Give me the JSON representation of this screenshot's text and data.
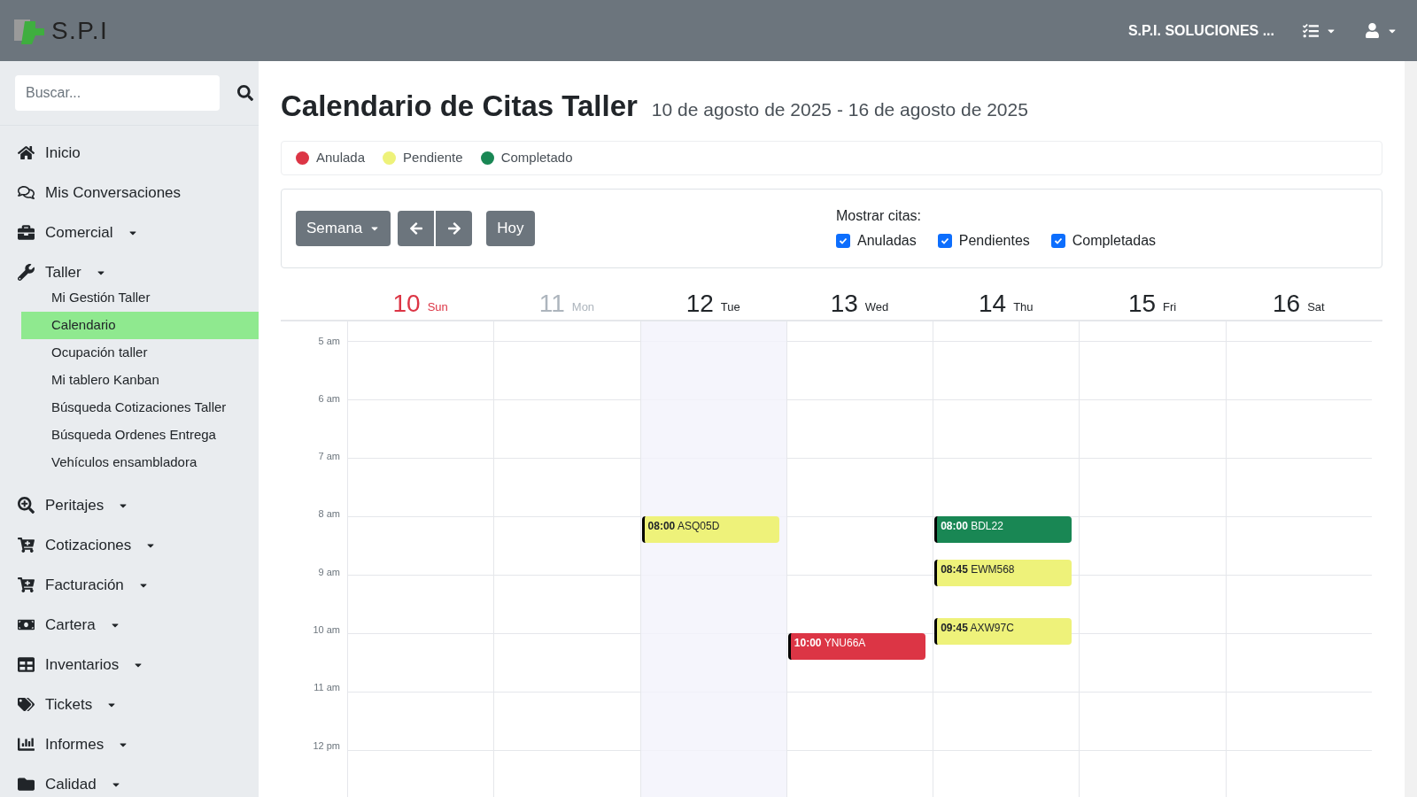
{
  "header": {
    "logo_text": "S.P.I",
    "company": "S.P.I. SOLUCIONES ..."
  },
  "sidebar": {
    "search": {
      "placeholder": "Buscar..."
    },
    "items": [
      {
        "label": "Inicio",
        "dropdown": false
      },
      {
        "label": "Mis Conversaciones",
        "dropdown": false
      },
      {
        "label": "Comercial",
        "dropdown": true
      },
      {
        "label": "Taller",
        "dropdown": true,
        "children": [
          {
            "label": "Mi Gestión Taller",
            "selected": false
          },
          {
            "label": "Calendario",
            "selected": true
          },
          {
            "label": "Ocupación taller",
            "selected": false
          },
          {
            "label": "Mi tablero Kanban",
            "selected": false
          },
          {
            "label": "Búsqueda Cotizaciones Taller",
            "selected": false
          },
          {
            "label": "Búsqueda Ordenes Entrega",
            "selected": false
          },
          {
            "label": "Vehículos ensambladora",
            "selected": false
          }
        ]
      },
      {
        "label": "Peritajes",
        "dropdown": true
      },
      {
        "label": "Cotizaciones",
        "dropdown": true
      },
      {
        "label": "Facturación",
        "dropdown": true
      },
      {
        "label": "Cartera",
        "dropdown": true
      },
      {
        "label": "Inventarios",
        "dropdown": true
      },
      {
        "label": "Tickets",
        "dropdown": true
      },
      {
        "label": "Informes",
        "dropdown": true
      },
      {
        "label": "Calidad",
        "dropdown": true
      }
    ]
  },
  "page": {
    "title": "Calendario de Citas Taller",
    "range": "10 de agosto de 2025 - 16 de agosto de 2025"
  },
  "legend": [
    {
      "label": "Anulada",
      "color": "#dc3545"
    },
    {
      "label": "Pendiente",
      "color": "#eef27a"
    },
    {
      "label": "Completado",
      "color": "#198754"
    }
  ],
  "toolbar": {
    "view": "Semana",
    "today": "Hoy",
    "filter_label": "Mostrar citas:",
    "filters": [
      {
        "label": "Anuladas",
        "checked": true
      },
      {
        "label": "Pendientes",
        "checked": true
      },
      {
        "label": "Completadas",
        "checked": true
      }
    ]
  },
  "calendar": {
    "hours": [
      "5 am",
      "6 am",
      "7 am",
      "8 am",
      "9 am",
      "10 am",
      "11 am",
      "12 pm"
    ],
    "days": [
      {
        "number": "10",
        "name": "Sun",
        "kind": "sunday",
        "selected": false
      },
      {
        "number": "11",
        "name": "Mon",
        "kind": "past",
        "selected": false
      },
      {
        "number": "12",
        "name": "Tue",
        "kind": "normal",
        "selected": true,
        "events": [
          {
            "time": "08:00",
            "plate": "ASQ05D",
            "color": "#eef27a"
          }
        ]
      },
      {
        "number": "13",
        "name": "Wed",
        "kind": "normal",
        "selected": false,
        "events": [
          {
            "time": "10:00",
            "plate": "YNU66A",
            "color": "#dc3545"
          }
        ]
      },
      {
        "number": "14",
        "name": "Thu",
        "kind": "normal",
        "selected": false,
        "events": [
          {
            "time": "08:00",
            "plate": "BDL22",
            "color": "#198754"
          },
          {
            "time": "08:45",
            "plate": "EWM568",
            "color": "#eef27a"
          },
          {
            "time": "09:45",
            "plate": "AXW97C",
            "color": "#eef27a"
          }
        ]
      },
      {
        "number": "15",
        "name": "Fri",
        "kind": "normal",
        "selected": false
      },
      {
        "number": "16",
        "name": "Sat",
        "kind": "normal",
        "selected": false
      }
    ]
  }
}
